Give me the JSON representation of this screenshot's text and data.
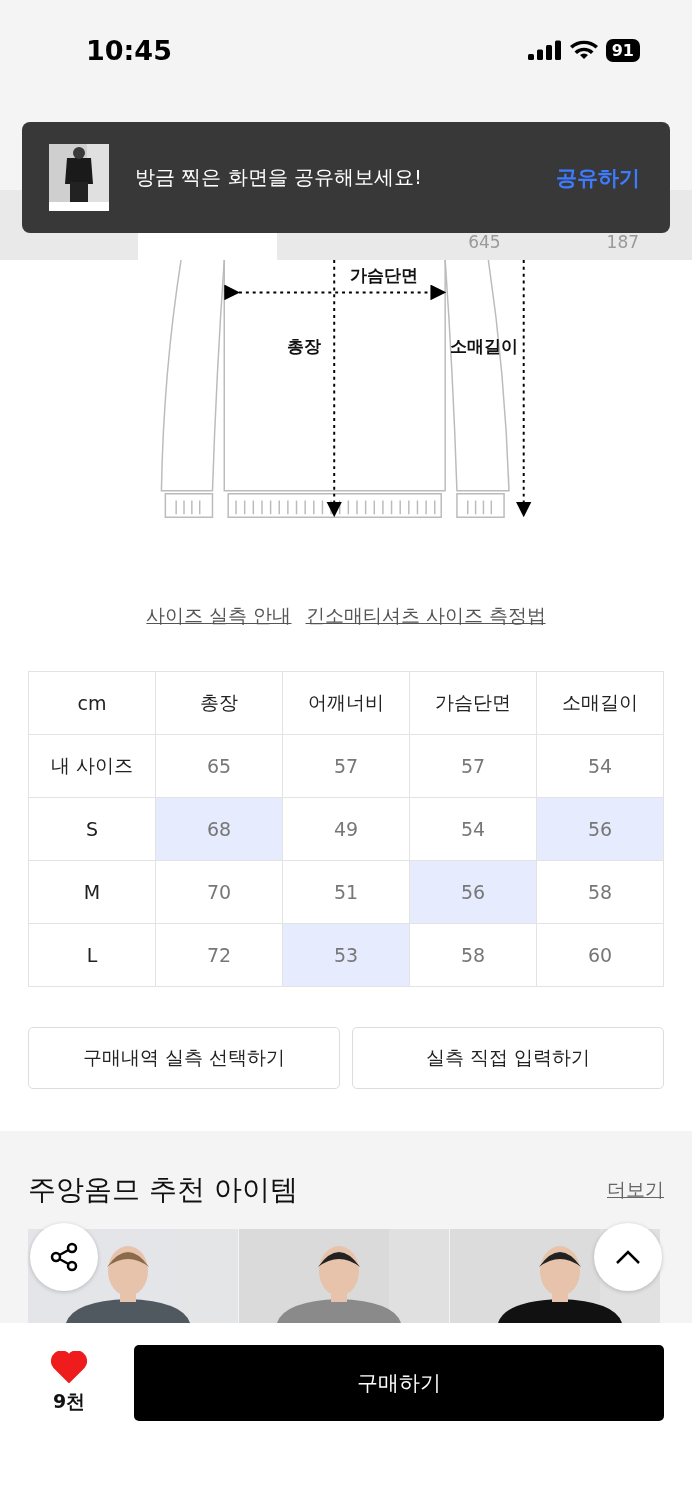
{
  "status_bar": {
    "time": "10:45",
    "battery": "91"
  },
  "tabs": [
    {
      "selected": false
    },
    {
      "selected": true
    },
    {
      "selected": false
    },
    {
      "count": "645",
      "selected": false
    },
    {
      "count": "187",
      "selected": false
    }
  ],
  "toast": {
    "message": "방금 찍은 화면을 공유해보세요!",
    "action": "공유하기"
  },
  "diagram": {
    "labels": [
      "가슴단면",
      "총장",
      "소매길이"
    ]
  },
  "links": [
    "사이즈 실측 안내",
    "긴소매티셔츠 사이즈 측정법"
  ],
  "size_table": {
    "columns": [
      "cm",
      "총장",
      "어깨너비",
      "가슴단면",
      "소매길이"
    ],
    "rows": [
      {
        "cells": [
          {
            "value": "내 사이즈",
            "highlighted": false
          },
          {
            "value": "65",
            "highlighted": false
          },
          {
            "value": "57",
            "highlighted": false
          },
          {
            "value": "57",
            "highlighted": false
          },
          {
            "value": "54",
            "highlighted": false
          }
        ]
      },
      {
        "cells": [
          {
            "value": "S",
            "highlighted": false
          },
          {
            "value": "68",
            "highlighted": true
          },
          {
            "value": "49",
            "highlighted": false
          },
          {
            "value": "54",
            "highlighted": false
          },
          {
            "value": "56",
            "highlighted": true
          }
        ]
      },
      {
        "cells": [
          {
            "value": "M",
            "highlighted": false
          },
          {
            "value": "70",
            "highlighted": false
          },
          {
            "value": "51",
            "highlighted": false
          },
          {
            "value": "56",
            "highlighted": true
          },
          {
            "value": "58",
            "highlighted": false
          }
        ]
      },
      {
        "cells": [
          {
            "value": "L",
            "highlighted": false
          },
          {
            "value": "72",
            "highlighted": false
          },
          {
            "value": "53",
            "highlighted": true
          },
          {
            "value": "58",
            "highlighted": false
          },
          {
            "value": "60",
            "highlighted": false
          }
        ]
      }
    ]
  },
  "actions": [
    "구매내역 실측 선택하기",
    "실측 직접 입력하기"
  ],
  "recommend": {
    "title": "주앙옴므 추천 아이템",
    "more": "더보기"
  },
  "bottom_bar": {
    "liked": true,
    "likes": "9천",
    "buy": "구매하기"
  }
}
